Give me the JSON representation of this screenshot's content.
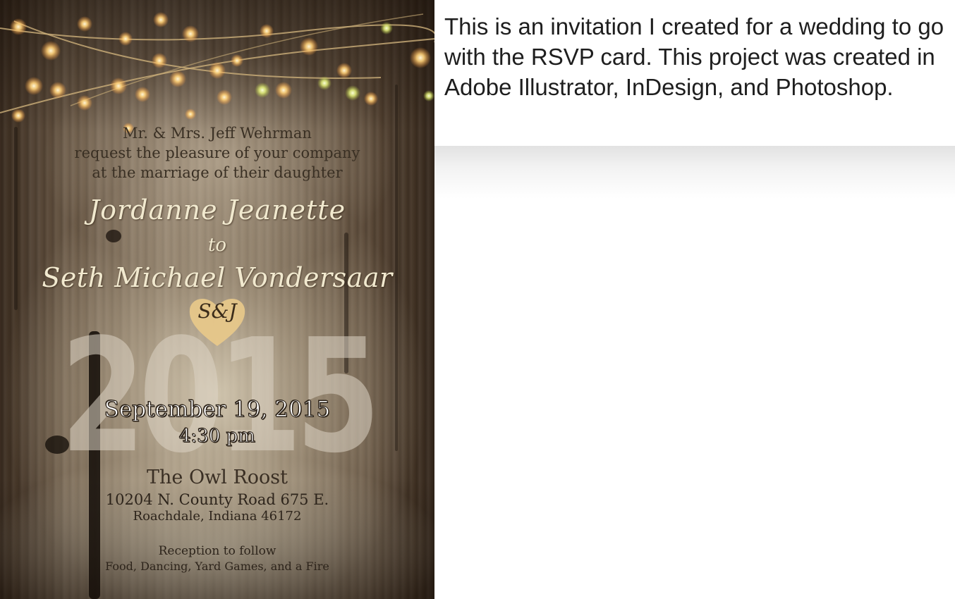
{
  "invitation": {
    "hosts": "Mr. & Mrs. Jeff Wehrman",
    "request_line": "request the pleasure of your company",
    "marriage_line": "at the marriage of their daughter",
    "bride": "Jordanne Jeanette",
    "connector": "to",
    "groom": "Seth Michael Vondersaar",
    "monogram": "S&J",
    "year": "2015",
    "date": "September 19, 2015",
    "time": "4:30 pm",
    "venue": "The Owl Roost",
    "address_line1": "10204 N. County Road 675 E.",
    "address_line2": "Roachdale, Indiana 46172",
    "reception": "Reception to follow",
    "reception_details": "Food, Dancing, Yard Games, and a Fire"
  },
  "caption": {
    "text": "This is an invitation I created for a wedding to go with the RSVP card.  This project was created in Adobe Illustrator, InDesign, and Photoshop."
  },
  "colors": {
    "wood": "#6b5a48",
    "text_dark": "#3a3024",
    "script_cream": "#f1e9cf",
    "heart_gold": "#e8c98a",
    "caption_text": "#1e1e1e"
  }
}
